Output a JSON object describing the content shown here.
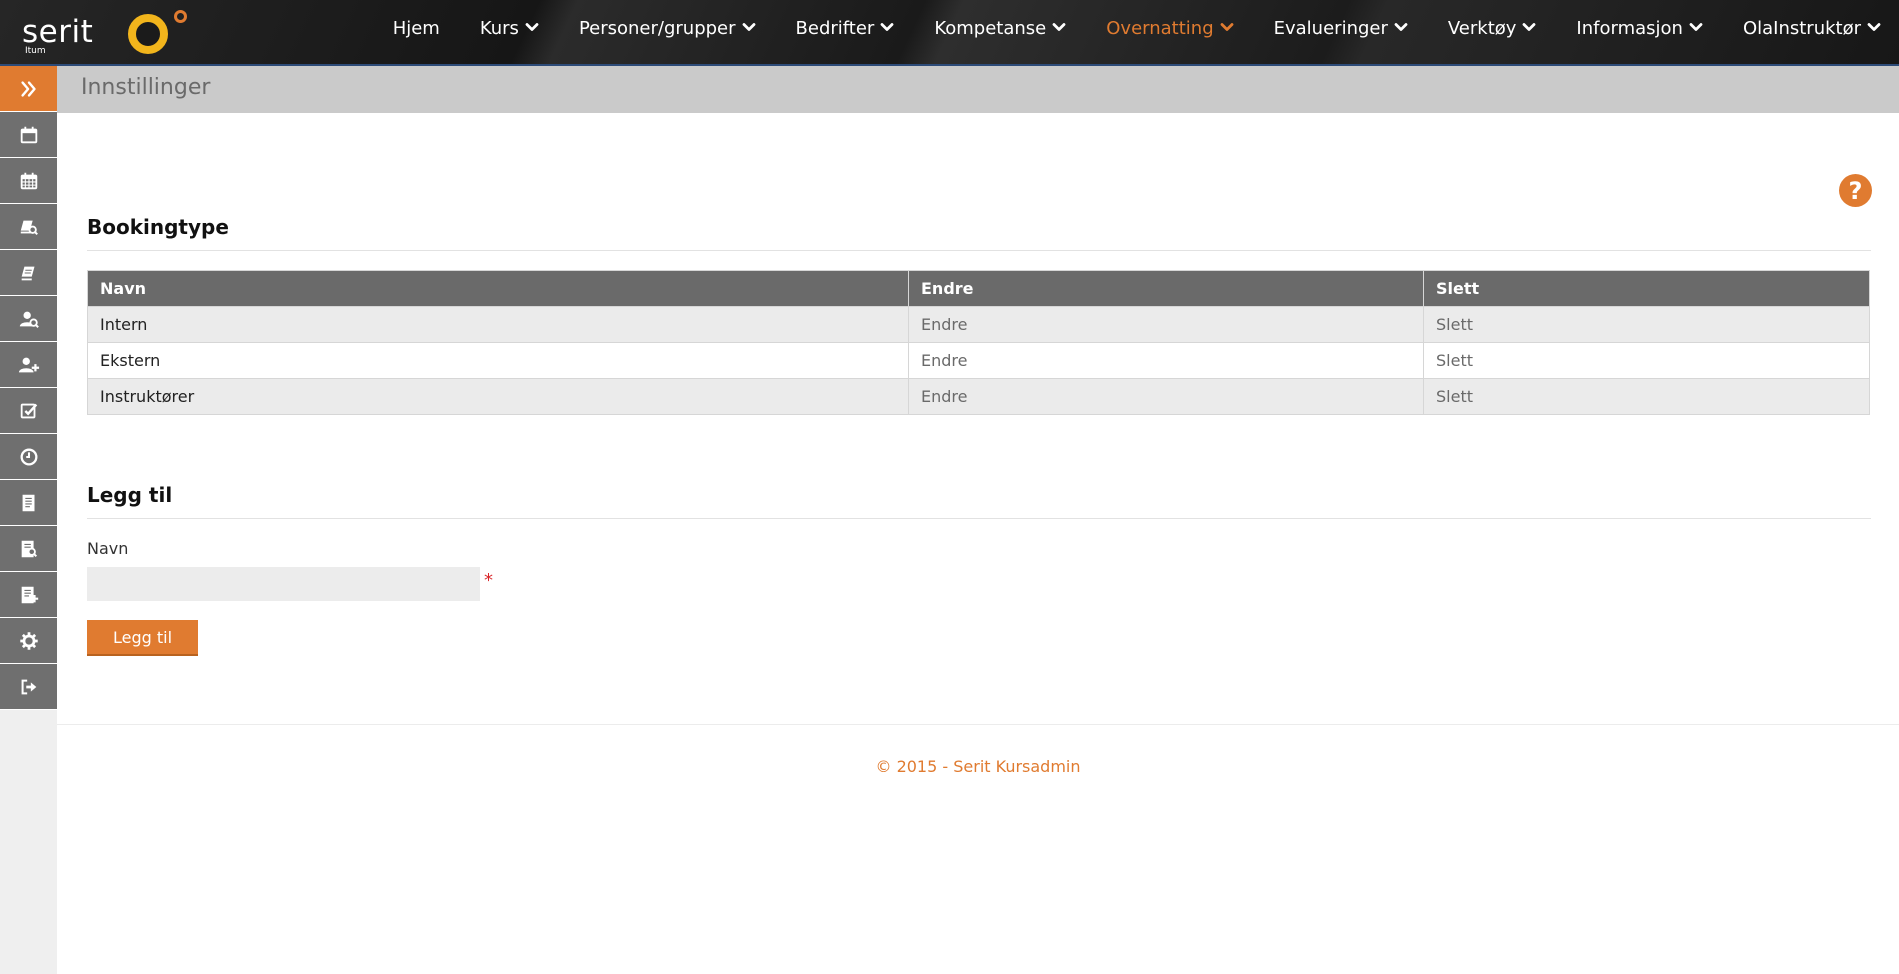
{
  "app": {
    "logo_text": "serit",
    "logo_subtext": "Itum"
  },
  "nav": {
    "items": [
      {
        "label": "Hjem",
        "dropdown": false,
        "active": false
      },
      {
        "label": "Kurs",
        "dropdown": true,
        "active": false
      },
      {
        "label": "Personer/grupper",
        "dropdown": true,
        "active": false
      },
      {
        "label": "Bedrifter",
        "dropdown": true,
        "active": false
      },
      {
        "label": "Kompetanse",
        "dropdown": true,
        "active": false
      },
      {
        "label": "Overnatting",
        "dropdown": true,
        "active": true
      },
      {
        "label": "Evalueringer",
        "dropdown": true,
        "active": false
      },
      {
        "label": "Verktøy",
        "dropdown": true,
        "active": false
      },
      {
        "label": "Informasjon",
        "dropdown": true,
        "active": false
      },
      {
        "label": "OlaInstruktør",
        "dropdown": true,
        "active": false
      }
    ]
  },
  "sidebar": {
    "toggle_icon": "double-chevron-right-icon",
    "items": [
      {
        "icon": "calendar-icon"
      },
      {
        "icon": "calendar-grid-icon"
      },
      {
        "icon": "course-search-icon"
      },
      {
        "icon": "course-edit-icon"
      },
      {
        "icon": "person-search-icon"
      },
      {
        "icon": "person-add-icon"
      },
      {
        "icon": "checkbox-icon"
      },
      {
        "icon": "clock-icon"
      },
      {
        "icon": "document-icon"
      },
      {
        "icon": "document-search-icon"
      },
      {
        "icon": "document-add-icon"
      },
      {
        "icon": "gear-icon"
      },
      {
        "icon": "sign-out-icon"
      }
    ]
  },
  "page": {
    "title": "Innstillinger",
    "help_icon": "question-circle-icon"
  },
  "bookingtype": {
    "heading": "Bookingtype",
    "columns": [
      "Navn",
      "Endre",
      "Slett"
    ],
    "rows": [
      {
        "name": "Intern",
        "edit": "Endre",
        "delete": "Slett"
      },
      {
        "name": "Ekstern",
        "edit": "Endre",
        "delete": "Slett"
      },
      {
        "name": "Instruktører",
        "edit": "Endre",
        "delete": "Slett"
      }
    ]
  },
  "add_form": {
    "heading": "Legg til",
    "name_label": "Navn",
    "name_value": "",
    "required_marker": "*",
    "submit_label": "Legg til"
  },
  "footer": {
    "text": "© 2015 - Serit Kursadmin"
  },
  "colors": {
    "accent": "#e07b30",
    "sidebar_item": "#6f6f6f",
    "header_bar": "#cacaca",
    "table_header": "#6a6a6a"
  }
}
